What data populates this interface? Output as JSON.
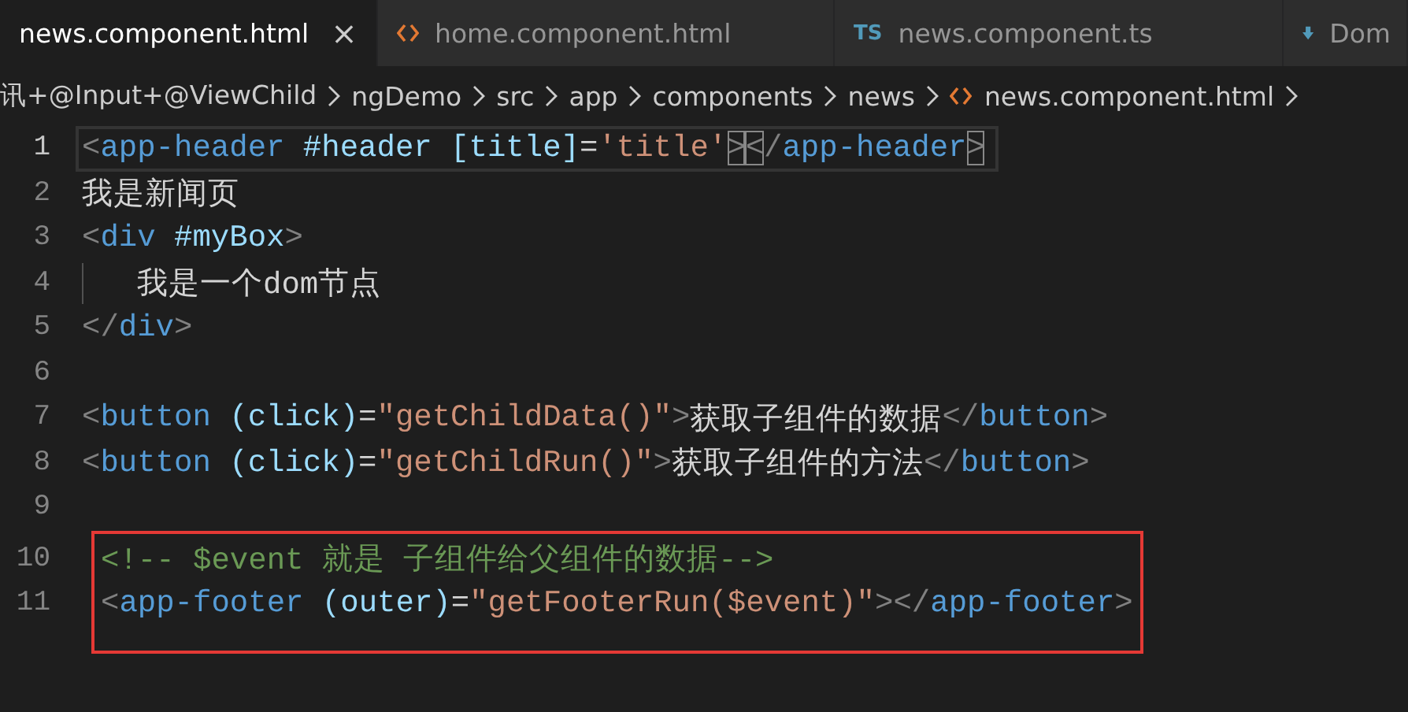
{
  "tabs": [
    {
      "label": "news.component.html",
      "kind": "plain",
      "selected": true,
      "close_label": "×"
    },
    {
      "label": "home.component.html",
      "kind": "html",
      "selected": false
    },
    {
      "label": "news.component.ts",
      "kind": "ts",
      "icon_text": "TS",
      "selected": false
    },
    {
      "label": "Dom",
      "kind": "download",
      "selected": false
    }
  ],
  "breadcrumb": [
    {
      "label": "讯+@Input+@ViewChild",
      "kind": "plain"
    },
    {
      "label": "ngDemo",
      "kind": "plain"
    },
    {
      "label": "src",
      "kind": "plain"
    },
    {
      "label": "app",
      "kind": "plain"
    },
    {
      "label": "components",
      "kind": "plain"
    },
    {
      "label": "news",
      "kind": "plain"
    },
    {
      "label": "news.component.html",
      "kind": "html"
    }
  ],
  "editor": {
    "lines": [
      {
        "number": "1",
        "current": true,
        "indent": false,
        "tokens": [
          {
            "kind": "bracket",
            "text": "<"
          },
          {
            "kind": "tag",
            "text": "app-header"
          },
          {
            "kind": "attr",
            "text": " #header"
          },
          {
            "kind": "attr",
            "text": " [title]"
          },
          {
            "kind": "plain",
            "text": "="
          },
          {
            "kind": "string",
            "text": "'title'"
          },
          {
            "kind": "match",
            "text": ">"
          },
          {
            "kind": "match",
            "text": "<"
          },
          {
            "kind": "bracket",
            "text": "/"
          },
          {
            "kind": "tag",
            "text": "app-header"
          },
          {
            "kind": "match",
            "text": ">"
          }
        ]
      },
      {
        "number": "2",
        "current": false,
        "indent": false,
        "tokens": [
          {
            "kind": "plain",
            "text": "我是新闻页"
          }
        ]
      },
      {
        "number": "3",
        "current": false,
        "indent": false,
        "tokens": [
          {
            "kind": "bracket",
            "text": "<"
          },
          {
            "kind": "tag",
            "text": "div"
          },
          {
            "kind": "attr",
            "text": " #myBox"
          },
          {
            "kind": "bracket",
            "text": ">"
          }
        ]
      },
      {
        "number": "4",
        "current": false,
        "indent": true,
        "tokens": [
          {
            "kind": "plain",
            "text": "我是一个dom节点"
          }
        ]
      },
      {
        "number": "5",
        "current": false,
        "indent": false,
        "tokens": [
          {
            "kind": "bracket",
            "text": "</"
          },
          {
            "kind": "tag",
            "text": "div"
          },
          {
            "kind": "bracket",
            "text": ">"
          }
        ]
      },
      {
        "number": "6",
        "current": false,
        "indent": false
      },
      {
        "number": "7",
        "current": false,
        "indent": false,
        "tokens": [
          {
            "kind": "bracket",
            "text": "<"
          },
          {
            "kind": "tag",
            "text": "button"
          },
          {
            "kind": "attr",
            "text": " (click)"
          },
          {
            "kind": "plain",
            "text": "="
          },
          {
            "kind": "string",
            "text": "\"getChildData()\""
          },
          {
            "kind": "bracket",
            "text": ">"
          },
          {
            "kind": "plain",
            "text": "获取子组件的数据"
          },
          {
            "kind": "bracket",
            "text": "</"
          },
          {
            "kind": "tag",
            "text": "button"
          },
          {
            "kind": "bracket",
            "text": ">"
          }
        ]
      },
      {
        "number": "8",
        "current": false,
        "indent": false,
        "tokens": [
          {
            "kind": "bracket",
            "text": "<"
          },
          {
            "kind": "tag",
            "text": "button"
          },
          {
            "kind": "attr",
            "text": " (click)"
          },
          {
            "kind": "plain",
            "text": "="
          },
          {
            "kind": "string",
            "text": "\"getChildRun()\""
          },
          {
            "kind": "bracket",
            "text": ">"
          },
          {
            "kind": "plain",
            "text": "获取子组件的方法"
          },
          {
            "kind": "bracket",
            "text": "</"
          },
          {
            "kind": "tag",
            "text": "button"
          },
          {
            "kind": "bracket",
            "text": ">"
          }
        ]
      },
      {
        "number": "9",
        "current": false,
        "indent": false
      }
    ],
    "highlight_box": {
      "lines": [
        {
          "number": "10",
          "tokens": [
            {
              "kind": "comment",
              "text": "<!-- $event 就是 子组件给父组件的数据-->"
            }
          ]
        },
        {
          "number": "11",
          "tokens": [
            {
              "kind": "bracket",
              "text": "<"
            },
            {
              "kind": "tag",
              "text": "app-footer"
            },
            {
              "kind": "attr",
              "text": " (outer)"
            },
            {
              "kind": "plain",
              "text": "="
            },
            {
              "kind": "string",
              "text": "\"getFooterRun($event)\""
            },
            {
              "kind": "bracket",
              "text": ">"
            },
            {
              "kind": "bracket",
              "text": "</"
            },
            {
              "kind": "tag",
              "text": "app-footer"
            },
            {
              "kind": "bracket",
              "text": ">"
            }
          ]
        }
      ]
    }
  }
}
